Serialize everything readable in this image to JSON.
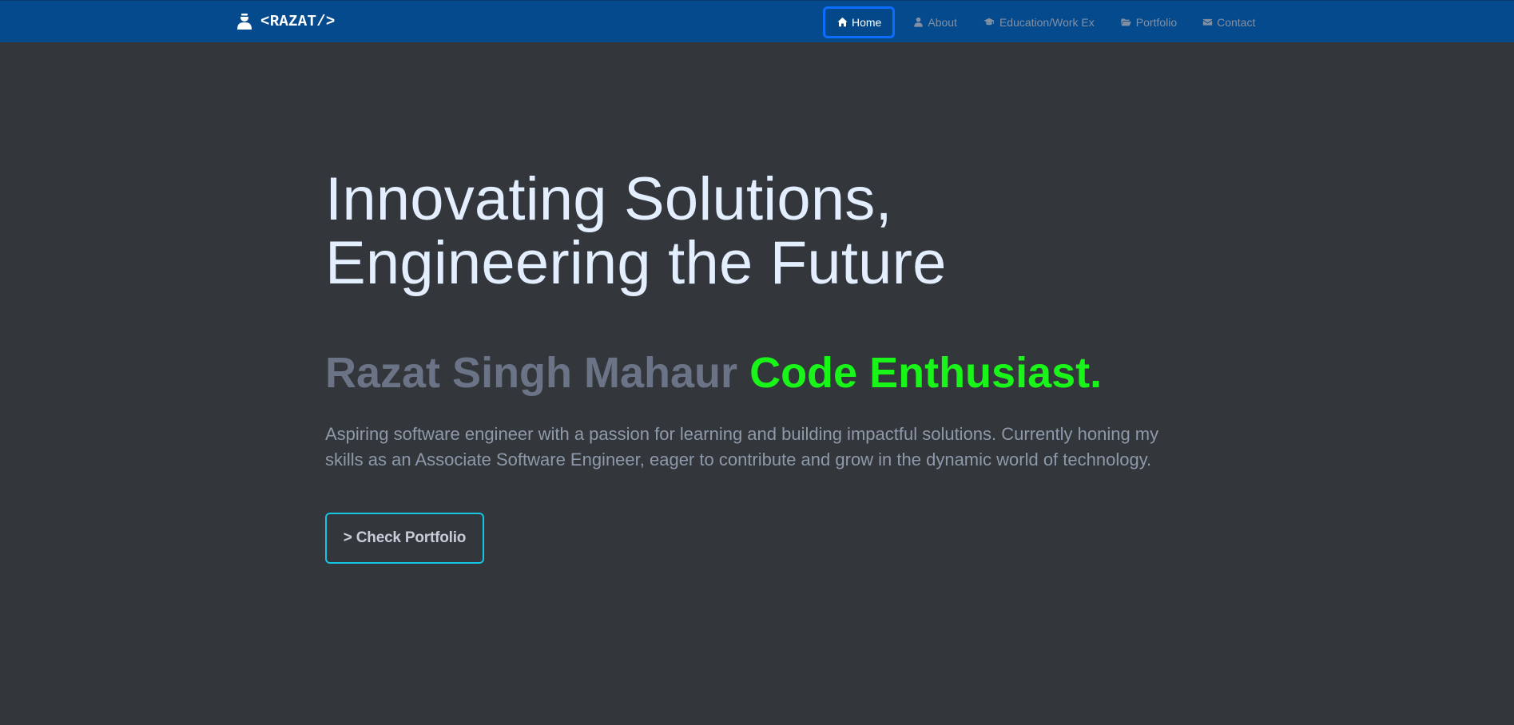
{
  "navbar": {
    "brand_text": "<RAZAT/>",
    "brand_icon": "user-icon",
    "background": "#054a8d",
    "items": [
      {
        "label": "Home",
        "icon": "home-icon",
        "active": true
      },
      {
        "label": "About",
        "icon": "user-icon",
        "active": false
      },
      {
        "label": "Education/Work Ex",
        "icon": "graduation-cap-icon",
        "active": false
      },
      {
        "label": "Portfolio",
        "icon": "folder-open-icon",
        "active": false
      },
      {
        "label": "Contact",
        "icon": "envelope-icon",
        "active": false
      }
    ]
  },
  "hero": {
    "headline_line1": "Innovating Solutions,",
    "headline_line2": "Engineering the Future",
    "name": "Razat Singh Mahaur",
    "role": "Code Enthusiast.",
    "bio": "Aspiring software engineer with a passion for learning and building impactful solutions. Currently honing my skills as an Associate Software Engineer, eager to contribute and grow in the dynamic world of technology.",
    "cta_label": "> Check Portfolio"
  },
  "colors": {
    "page_background": "#33363b",
    "accent_green": "#19f519",
    "accent_cyan": "#14c6e1",
    "active_border": "#0d6efd"
  }
}
